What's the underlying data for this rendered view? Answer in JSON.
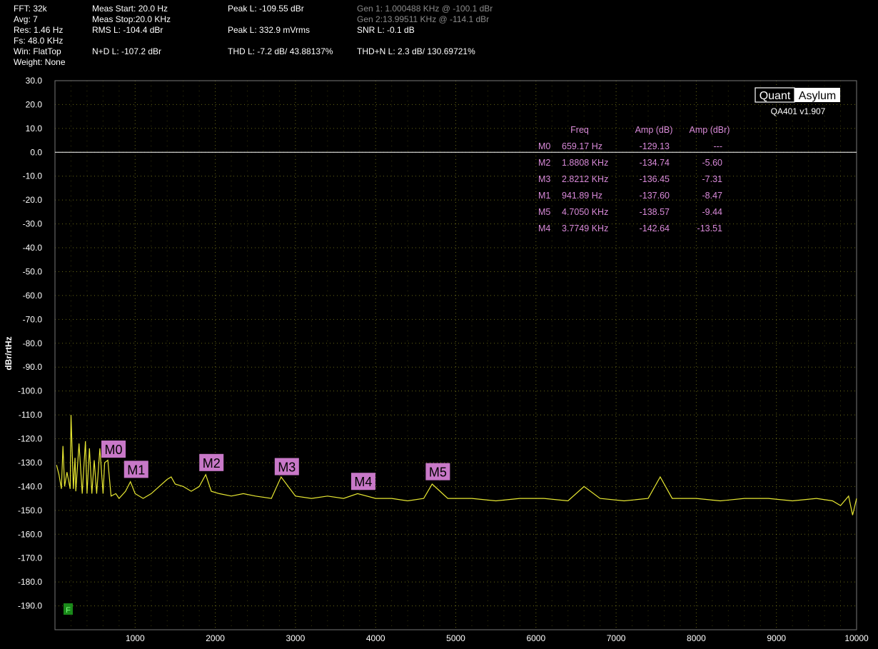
{
  "stats": {
    "fft": "FFT: 32k",
    "avg": "Avg: 7",
    "res": "Res: 1.46 Hz",
    "fs": "Fs: 48.0 KHz",
    "win": "Win: FlatTop",
    "weight": "Weight: None",
    "meas_start": "Meas Start: 20.0 Hz",
    "meas_stop": "Meas Stop:20.0 KHz",
    "rms": "RMS L: -104.4 dBr",
    "nd": "N+D L: -107.2 dBr",
    "peak_dbr": "Peak L: -109.55 dBr",
    "peak_vrms": "Peak L: 332.9 mVrms",
    "thd": "THD L: -7.2 dB/ 43.88137%",
    "gen1": "Gen 1: 1.000488 KHz @ -100.1  dBr",
    "gen2": "Gen 2:13.99511 KHz @ -114.1  dBr",
    "snr": "SNR L: -0.1 dB",
    "thdn": "THD+N L: 2.3 dB/ 130.69721%"
  },
  "brand": {
    "quant": "Quant",
    "asylum": "Asylum",
    "version": "QA401 v1.907"
  },
  "markers_table": {
    "headers": [
      "Freq",
      "Amp (dB)",
      "Amp (dBr)"
    ],
    "rows": [
      [
        "M0",
        "659.17 Hz",
        "-129.13",
        "---"
      ],
      [
        "M2",
        "1.8808 KHz",
        "-134.74",
        "-5.60"
      ],
      [
        "M3",
        "2.8212 KHz",
        "-136.45",
        "-7.31"
      ],
      [
        "M1",
        "941.89 Hz",
        "-137.60",
        "-8.47"
      ],
      [
        "M5",
        "4.7050 KHz",
        "-138.57",
        "-9.44"
      ],
      [
        "M4",
        "3.7749 KHz",
        "-142.64",
        "-13.51"
      ]
    ]
  },
  "f_badge": "F",
  "colors": {
    "trace": "#e8e832",
    "marker_bg": "#c878c8",
    "table_text": "#d98ad9",
    "grid": "#bfbf2a",
    "zero_line": "#ffffff",
    "f_badge": "#1a8a1a"
  },
  "chart_data": {
    "type": "line",
    "ylabel": "dBr/rtHz",
    "xlabel": "",
    "xlim": [
      0,
      10000
    ],
    "ylim": [
      -200,
      30
    ],
    "x_ticks": [
      1000,
      2000,
      3000,
      4000,
      5000,
      6000,
      7000,
      8000,
      9000,
      10000
    ],
    "y_ticks": [
      30,
      20,
      10,
      0,
      -10,
      -20,
      -30,
      -40,
      -50,
      -60,
      -70,
      -80,
      -90,
      -100,
      -110,
      -120,
      -130,
      -140,
      -150,
      -160,
      -170,
      -180,
      -190
    ],
    "grid": true,
    "reference_line_y": 0,
    "series": [
      {
        "x": [
          20,
          50,
          80,
          100,
          120,
          150,
          190,
          200,
          230,
          250,
          260,
          300,
          340,
          380,
          400,
          430,
          460,
          490,
          520,
          560,
          600,
          620,
          659,
          700,
          760,
          800,
          880,
          941,
          1000,
          1100,
          1200,
          1300,
          1400,
          1450,
          1500,
          1600,
          1700,
          1800,
          1881,
          1950,
          2050,
          2200,
          2350,
          2500,
          2700,
          2821,
          3000,
          3200,
          3400,
          3600,
          3775,
          4000,
          4200,
          4400,
          4600,
          4705,
          4900,
          5200,
          5500,
          5800,
          6100,
          6400,
          6600,
          6800,
          7100,
          7400,
          7550,
          7700,
          8000,
          8300,
          8600,
          8900,
          9200,
          9500,
          9700,
          9800,
          9900,
          9950,
          10000
        ],
        "values": [
          -131,
          -135,
          -141,
          -123,
          -140,
          -134,
          -141,
          -110,
          -141,
          -128,
          -142,
          -122,
          -143,
          -121,
          -143,
          -124,
          -143,
          -129,
          -143,
          -124,
          -143,
          -130,
          -129,
          -144,
          -143,
          -145,
          -142,
          -138,
          -143,
          -145,
          -143,
          -140,
          -137,
          -136,
          -139,
          -140,
          -142,
          -140,
          -135,
          -142,
          -143,
          -144,
          -143,
          -144,
          -145,
          -136,
          -144,
          -145,
          -144,
          -145,
          -143,
          -145,
          -145,
          -146,
          -145,
          -139,
          -145,
          -145,
          -146,
          -145,
          -145,
          -146,
          -140,
          -145,
          -146,
          -145,
          -136,
          -145,
          -145,
          -146,
          -145,
          -145,
          -146,
          -145,
          -146,
          -148,
          -144,
          -152,
          -145
        ]
      }
    ],
    "markers": [
      {
        "name": "M0",
        "x": 659.17,
        "y": -129.13
      },
      {
        "name": "M1",
        "x": 941.89,
        "y": -137.6
      },
      {
        "name": "M2",
        "x": 1880.8,
        "y": -134.74
      },
      {
        "name": "M3",
        "x": 2821.2,
        "y": -136.45
      },
      {
        "name": "M4",
        "x": 3774.9,
        "y": -142.64
      },
      {
        "name": "M5",
        "x": 4705.0,
        "y": -138.57
      }
    ]
  }
}
